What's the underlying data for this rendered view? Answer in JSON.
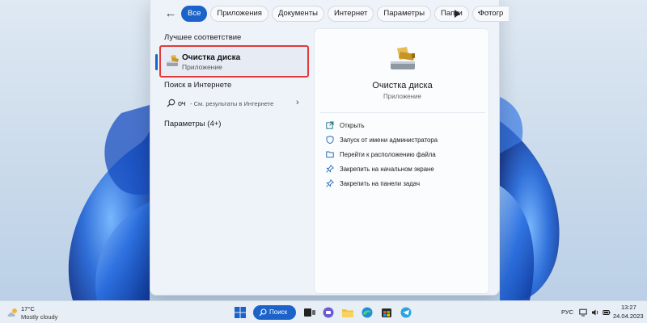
{
  "filters": {
    "back_icon": "arrow-left-icon",
    "chips": [
      "Все",
      "Приложения",
      "Документы",
      "Интернет",
      "Параметры",
      "Папки",
      "Фотогр"
    ],
    "active_chip": "Все",
    "more_icon": "play-right-icon",
    "overflow": "···"
  },
  "results": {
    "best_match_heading": "Лучшее соответствие",
    "best_match": {
      "name": "Очистка диска",
      "type": "Приложение",
      "icon": "disk-cleanup-icon"
    },
    "web_heading": "Поиск в Интернете",
    "web": {
      "query": "оч",
      "hint": "- См. результаты в Интернете",
      "icon": "search-icon",
      "chevron": "›"
    },
    "settings_heading": "Параметры (4+)"
  },
  "details": {
    "name": "Очистка диска",
    "type": "Приложение",
    "actions": [
      {
        "label": "Открыть",
        "icon": "open-external-icon"
      },
      {
        "label": "Запуск от имени администратора",
        "icon": "shield-icon"
      },
      {
        "label": "Перейти к расположению файла",
        "icon": "folder-icon"
      },
      {
        "label": "Закрепить на начальном экране",
        "icon": "pin-icon"
      },
      {
        "label": "Закрепить на панели задач",
        "icon": "pin-icon"
      }
    ]
  },
  "taskbar": {
    "weather": {
      "temp": "17°C",
      "condition": "Mostly cloudy",
      "icon": "cloud-sun-icon"
    },
    "search_label": "Поиск",
    "apps": [
      "windows-start-icon",
      "task-view-icon",
      "teams-chat-icon",
      "file-explorer-icon",
      "edge-icon",
      "store-icon",
      "telegram-icon"
    ],
    "tray": {
      "language": "РУС",
      "time": "13:27",
      "date": "24.04.2023"
    }
  },
  "colors": {
    "accent": "#1b62c9",
    "highlight_border": "#e03a3a",
    "panel": "#eef2f9"
  }
}
